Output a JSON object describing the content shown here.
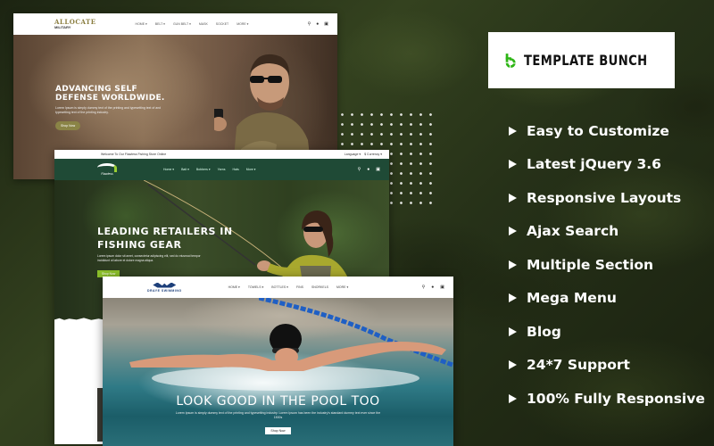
{
  "brand": {
    "name": "TEMPLATE BUNCH",
    "logo_color": "#2db515"
  },
  "features": [
    {
      "label": "Easy to Customize"
    },
    {
      "label": "Latest jQuery 3.6"
    },
    {
      "label": "Responsive Layouts"
    },
    {
      "label": "Ajax Search"
    },
    {
      "label": "Multiple Section"
    },
    {
      "label": "Mega Menu"
    },
    {
      "label": "Blog"
    },
    {
      "label": "24*7 Support"
    },
    {
      "label": "100% Fully Responsive"
    }
  ],
  "mockups": {
    "military": {
      "logo_title": "ALLOCATE",
      "logo_subtitle": "MILITARY",
      "nav": [
        "HOME ▾",
        "BELT ▾",
        "GUN BELT ▾",
        "MASK",
        "SOCKET",
        "MORE ▾"
      ],
      "hero_title_line1": "ADVANCING SELF",
      "hero_title_line2": "DEFENSE WORLDWIDE.",
      "hero_desc": "Lorem Ipsum is simply dummy text of the printing and typesetting text of and typesetting text of the printing industry.",
      "button": "Shop Now",
      "accent": "#8a8446"
    },
    "fishing": {
      "topbar_welcome": "Welcome To Our Flawless Fishing Store Online",
      "topbar_language": "Language ▾",
      "topbar_currency": "$ Currency ▾",
      "logo_text": "Flawless",
      "nav": [
        "Home ▾",
        "Bait ▾",
        "Bobbers ▾",
        "Yarns",
        "Hats",
        "More ▾"
      ],
      "hero_title_line1": "LEADING RETAILERS IN",
      "hero_title_line2": "FISHING GEAR",
      "hero_desc": "Lorem ipsum dolor sit amet, consectetur adipiscing elit, sed do eiusmod tempor incididunt ut labore et dolore magna aliqua.",
      "button": "Shop Now",
      "header_color": "#1f4a36",
      "accent": "#8cbf2a"
    },
    "swimming": {
      "logo_text": "DRAYE SWIMMING",
      "nav": [
        "HOME ▾",
        "TOWELS ▾",
        "BOTTLES ▾",
        "FINS",
        "SNORKELS",
        "MORE ▾"
      ],
      "hero_title": "LOOK GOOD IN THE POOL TOO",
      "hero_desc": "Lorem Ipsum is simply dummy text of the printing and typesetting industry. Lorem Ipsum has been the industry's standard dummy text ever since the 1500s",
      "button": "Shop Now",
      "accent": "#1d3f7a"
    }
  }
}
